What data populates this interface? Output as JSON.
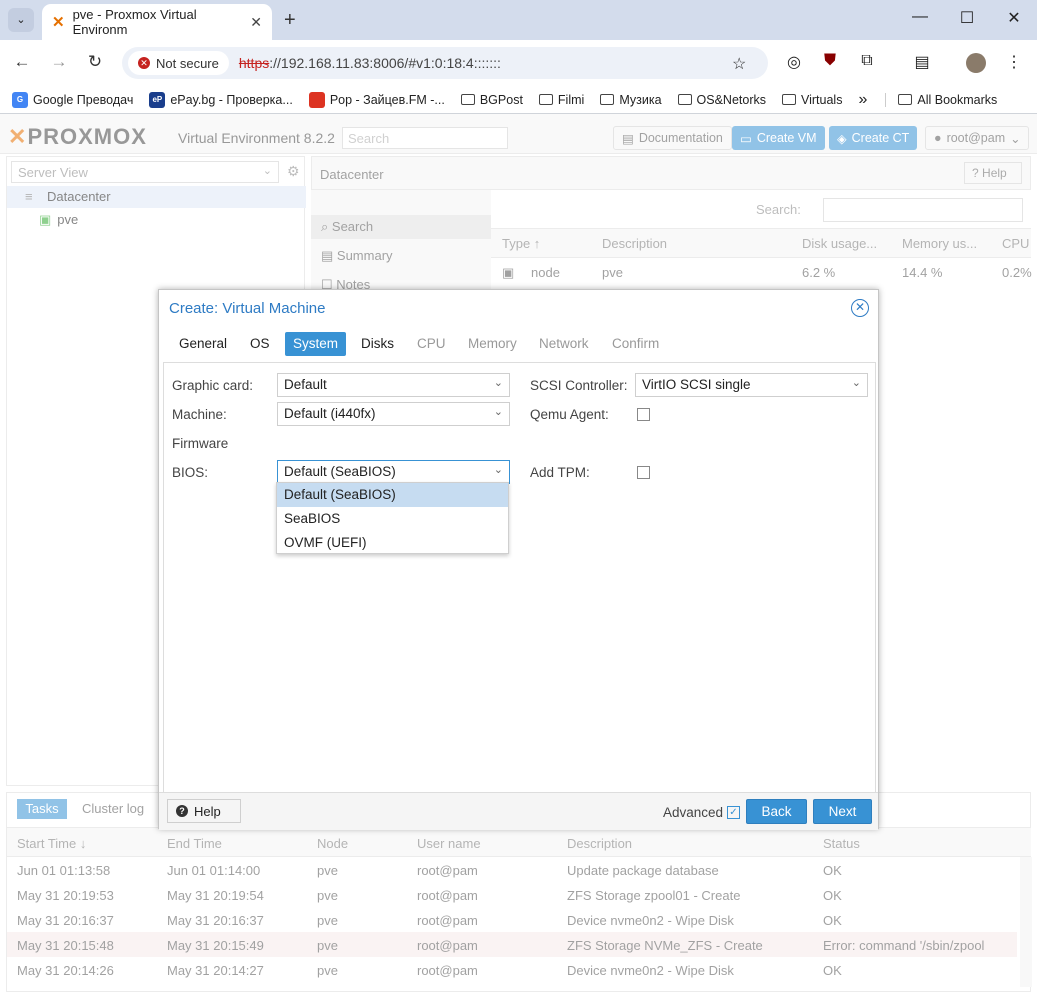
{
  "browser": {
    "tab_title": "pve - Proxmox Virtual Environm",
    "not_secure": "Not secure",
    "url_scheme": "https",
    "url_rest": "://192.168.11.83:8006/#v1:0:18:4:::::::",
    "bookmarks": [
      {
        "label": "Google Преводач",
        "icon": "google-translate-icon"
      },
      {
        "label": "ePay.bg - Проверка...",
        "icon": "epay-icon"
      },
      {
        "label": "Pop - Зайцев.FM -...",
        "icon": "zaycev-icon"
      },
      {
        "label": "BGPost",
        "icon": "folder-icon"
      },
      {
        "label": "Filmi",
        "icon": "folder-icon"
      },
      {
        "label": "Музика",
        "icon": "folder-icon"
      },
      {
        "label": "OS&Netorks",
        "icon": "folder-icon"
      },
      {
        "label": "Virtuals",
        "icon": "folder-icon"
      }
    ],
    "more": "»",
    "all_bookmarks": "All Bookmarks"
  },
  "pve": {
    "logo": "PROXMOX",
    "version": "Virtual Environment 8.2.2",
    "search_placeholder": "Search",
    "documentation": "Documentation",
    "create_vm": "Create VM",
    "create_ct": "Create CT",
    "user": "root@pam",
    "server_view": "Server View",
    "datacenter": "Datacenter",
    "node_name": "pve",
    "center_title": "Datacenter",
    "help": "Help",
    "sidenav": [
      "Search",
      "Summary",
      "Notes"
    ],
    "grid_search_label": "Search:",
    "grid_headers": [
      "Type ↑",
      "Description",
      "Disk usage...",
      "Memory us...",
      "CPU"
    ],
    "grid_row": [
      "node",
      "pve",
      "6.2 %",
      "14.4 %",
      "0.2%"
    ]
  },
  "tasks": {
    "tab_tasks": "Tasks",
    "tab_cluster": "Cluster log",
    "headers": [
      "Start Time ↓",
      "End Time",
      "Node",
      "User name",
      "Description",
      "Status"
    ],
    "rows": [
      {
        "start": "Jun 01 01:13:58",
        "end": "Jun 01 01:14:00",
        "node": "pve",
        "user": "root@pam",
        "desc": "Update package database",
        "status": "OK"
      },
      {
        "start": "May 31 20:19:53",
        "end": "May 31 20:19:54",
        "node": "pve",
        "user": "root@pam",
        "desc": "ZFS Storage zpool01 - Create",
        "status": "OK"
      },
      {
        "start": "May 31 20:16:37",
        "end": "May 31 20:16:37",
        "node": "pve",
        "user": "root@pam",
        "desc": "Device nvme0n2 - Wipe Disk",
        "status": "OK"
      },
      {
        "start": "May 31 20:15:48",
        "end": "May 31 20:15:49",
        "node": "pve",
        "user": "root@pam",
        "desc": "ZFS Storage NVMe_ZFS - Create",
        "status": "Error: command '/sbin/zpool"
      },
      {
        "start": "May 31 20:14:26",
        "end": "May 31 20:14:27",
        "node": "pve",
        "user": "root@pam",
        "desc": "Device nvme0n2 - Wipe Disk",
        "status": "OK"
      }
    ]
  },
  "dialog": {
    "title": "Create: Virtual Machine",
    "tabs": [
      "General",
      "OS",
      "System",
      "Disks",
      "CPU",
      "Memory",
      "Network",
      "Confirm"
    ],
    "graphic_card_label": "Graphic card:",
    "graphic_card_value": "Default",
    "machine_label": "Machine:",
    "machine_value": "Default (i440fx)",
    "firmware_label": "Firmware",
    "bios_label": "BIOS:",
    "bios_value": "Default (SeaBIOS)",
    "scsi_label": "SCSI Controller:",
    "scsi_value": "VirtIO SCSI single",
    "qemu_label": "Qemu Agent:",
    "tpm_label": "Add TPM:",
    "bios_options": [
      "Default (SeaBIOS)",
      "SeaBIOS",
      "OVMF (UEFI)"
    ],
    "help": "Help",
    "advanced": "Advanced",
    "back": "Back",
    "next": "Next"
  },
  "colors": {
    "accent": "#3892d4",
    "brand": "#e57000",
    "error_row": "#f6e9ea"
  }
}
